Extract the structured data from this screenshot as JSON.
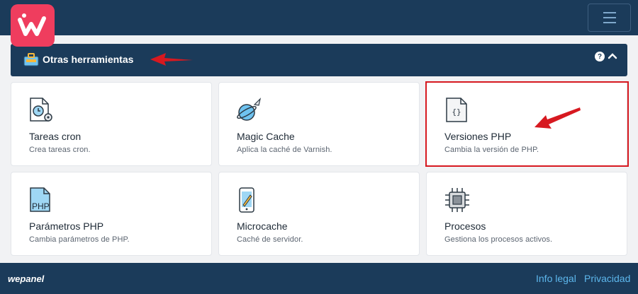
{
  "header": {
    "logo_letter": "w",
    "menu_icon": "hamburger-icon",
    "brand_color": "#ef3d5e",
    "bar_color": "#1b3b5a"
  },
  "section": {
    "title": "Otras herramientas",
    "icon": "toolbox-icon",
    "help": "?",
    "collapse_icon": "chevron-up-icon"
  },
  "tools": [
    {
      "title": "Tareas cron",
      "desc": "Crea tareas cron.",
      "icon": "cron-file-icon"
    },
    {
      "title": "Magic Cache",
      "desc": "Aplica la caché de Varnish.",
      "icon": "planet-rocket-icon"
    },
    {
      "title": "Versiones PHP",
      "desc": "Cambia la versión de PHP.",
      "icon": "code-file-icon"
    },
    {
      "title": "Parámetros PHP",
      "desc": "Cambia parámetros de PHP.",
      "icon": "php-file-icon"
    },
    {
      "title": "Microcache",
      "desc": "Caché de servidor.",
      "icon": "phone-rocket-icon"
    },
    {
      "title": "Procesos",
      "desc": "Gestiona los procesos activos.",
      "icon": "cpu-chip-icon"
    }
  ],
  "annotations": {
    "color": "#d71920"
  },
  "footer": {
    "brand": "wepanel",
    "links": [
      "Info legal",
      "Privacidad"
    ],
    "link_color": "#5db7ec"
  }
}
